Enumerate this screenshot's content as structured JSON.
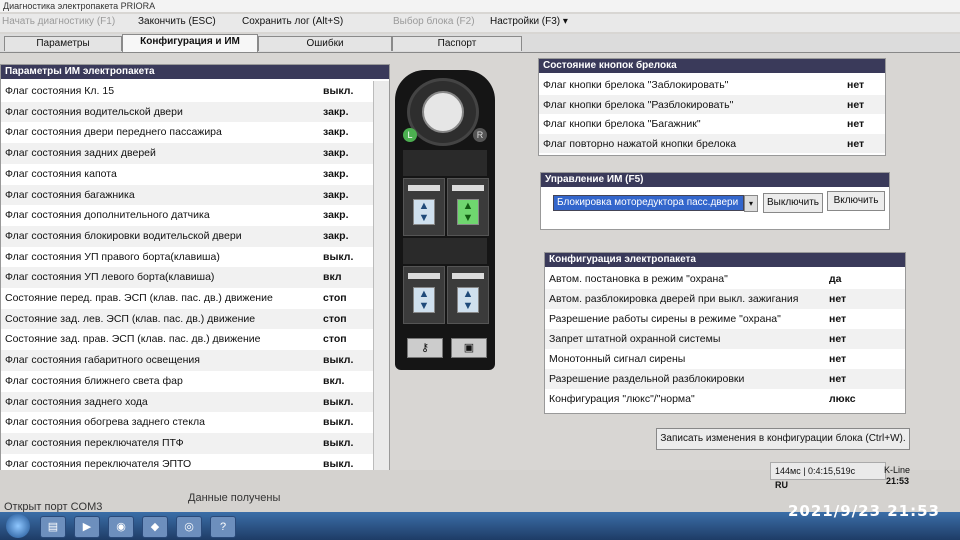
{
  "window": {
    "title": "Диагностика электропакета PRIORA"
  },
  "menu": {
    "items": [
      {
        "label": "Начать диагностику (F1)",
        "disabled": true
      },
      {
        "label": "Закончить (ESC)",
        "disabled": false
      },
      {
        "label": "Сохранить лог (Alt+S)",
        "disabled": false
      },
      {
        "label": "Выбор блока (F2)",
        "disabled": true
      },
      {
        "label": "Настройки (F3) ▾",
        "disabled": false
      }
    ]
  },
  "tabs": [
    {
      "label": "Параметры",
      "active": false
    },
    {
      "label": "Конфигурация и ИМ",
      "active": true
    },
    {
      "label": "Ошибки",
      "active": false
    },
    {
      "label": "Паспорт",
      "active": false
    }
  ],
  "params_panel": {
    "title": "Параметры ИМ электропакета",
    "rows": [
      {
        "label": "Флаг состояния Кл. 15",
        "value": "выкл."
      },
      {
        "label": "Флаг состояния водительской двери",
        "value": "закр."
      },
      {
        "label": "Флаг состояния двери переднего пассажира",
        "value": "закр."
      },
      {
        "label": "Флаг состояния задних дверей",
        "value": "закр."
      },
      {
        "label": "Флаг состояния капота",
        "value": "закр."
      },
      {
        "label": "Флаг состояния багажника",
        "value": "закр."
      },
      {
        "label": "Флаг состояния дополнительного датчика",
        "value": "закр."
      },
      {
        "label": "Флаг состояния блокировки водительской двери",
        "value": "закр."
      },
      {
        "label": "Флаг состояния УП правого борта(клавиша)",
        "value": "выкл."
      },
      {
        "label": "Флаг состояния УП левого борта(клавиша)",
        "value": "вкл"
      },
      {
        "label": "Состояние перед. прав. ЭСП (клав. пас. дв.) движение",
        "value": "стоп"
      },
      {
        "label": "Состояние зад. лев. ЭСП (клав. пас. дв.) движение",
        "value": "стоп"
      },
      {
        "label": "Состояние зад. прав. ЭСП (клав. пас. дв.) движение",
        "value": "стоп"
      },
      {
        "label": "Флаг состояния габаритного освещения",
        "value": "выкл."
      },
      {
        "label": "Флаг состояния ближнего света фар",
        "value": "вкл."
      },
      {
        "label": "Флаг состояния заднего хода",
        "value": "выкл."
      },
      {
        "label": "Флаг состояния обогрева заднего стекла",
        "value": "выкл."
      },
      {
        "label": "Флаг состояния переключателя ПТФ",
        "value": "выкл."
      },
      {
        "label": "Флаг состояния переключателя ЭПТО",
        "value": "выкл."
      }
    ]
  },
  "keyfob_panel": {
    "title": "Состояние кнопок брелока",
    "rows": [
      {
        "label": "Флаг кнопки брелока \"Заблокировать\"",
        "value": "нет"
      },
      {
        "label": "Флаг кнопки брелока \"Разблокировать\"",
        "value": "нет"
      },
      {
        "label": "Флаг кнопки брелока \"Багажник\"",
        "value": "нет"
      },
      {
        "label": "Флаг повторно нажатой кнопки брелока",
        "value": "нет"
      }
    ]
  },
  "control_panel": {
    "title": "Управление ИМ (F5)",
    "selected": "Блокировка моторедуктора пасс.двери",
    "off_label": "Выключить",
    "on_label": "Включить"
  },
  "config_panel": {
    "title": "Конфигурация электропакета",
    "rows": [
      {
        "label": "Автом. постановка в режим \"охрана\"",
        "value": "да"
      },
      {
        "label": "Автом. разблокировка дверей при выкл. зажигания",
        "value": "нет"
      },
      {
        "label": "Разрешение работы сирены в режиме \"охрана\"",
        "value": "нет"
      },
      {
        "label": "Запрет штатной охранной системы",
        "value": "нет"
      },
      {
        "label": "Монотонный сигнал сирены",
        "value": "нет"
      },
      {
        "label": "Разрешение раздельной разблокировки",
        "value": "нет"
      },
      {
        "label": "Конфигурация \"люкс\"/\"норма\"",
        "value": "люкс"
      }
    ],
    "write_label": "Записать изменения в конфигурации блока (Ctrl+W)."
  },
  "keyfob_icons": {
    "left": "L",
    "right": "R"
  },
  "status": {
    "port": "Открыт порт COM3",
    "data": "Данные получены",
    "timing": "144мс | 0:4:15,519с",
    "protocol": "K-Line"
  },
  "taskbar": {
    "lang": "RU",
    "time": "21:53"
  },
  "photo_stamp": "2021/9/23  21:53"
}
